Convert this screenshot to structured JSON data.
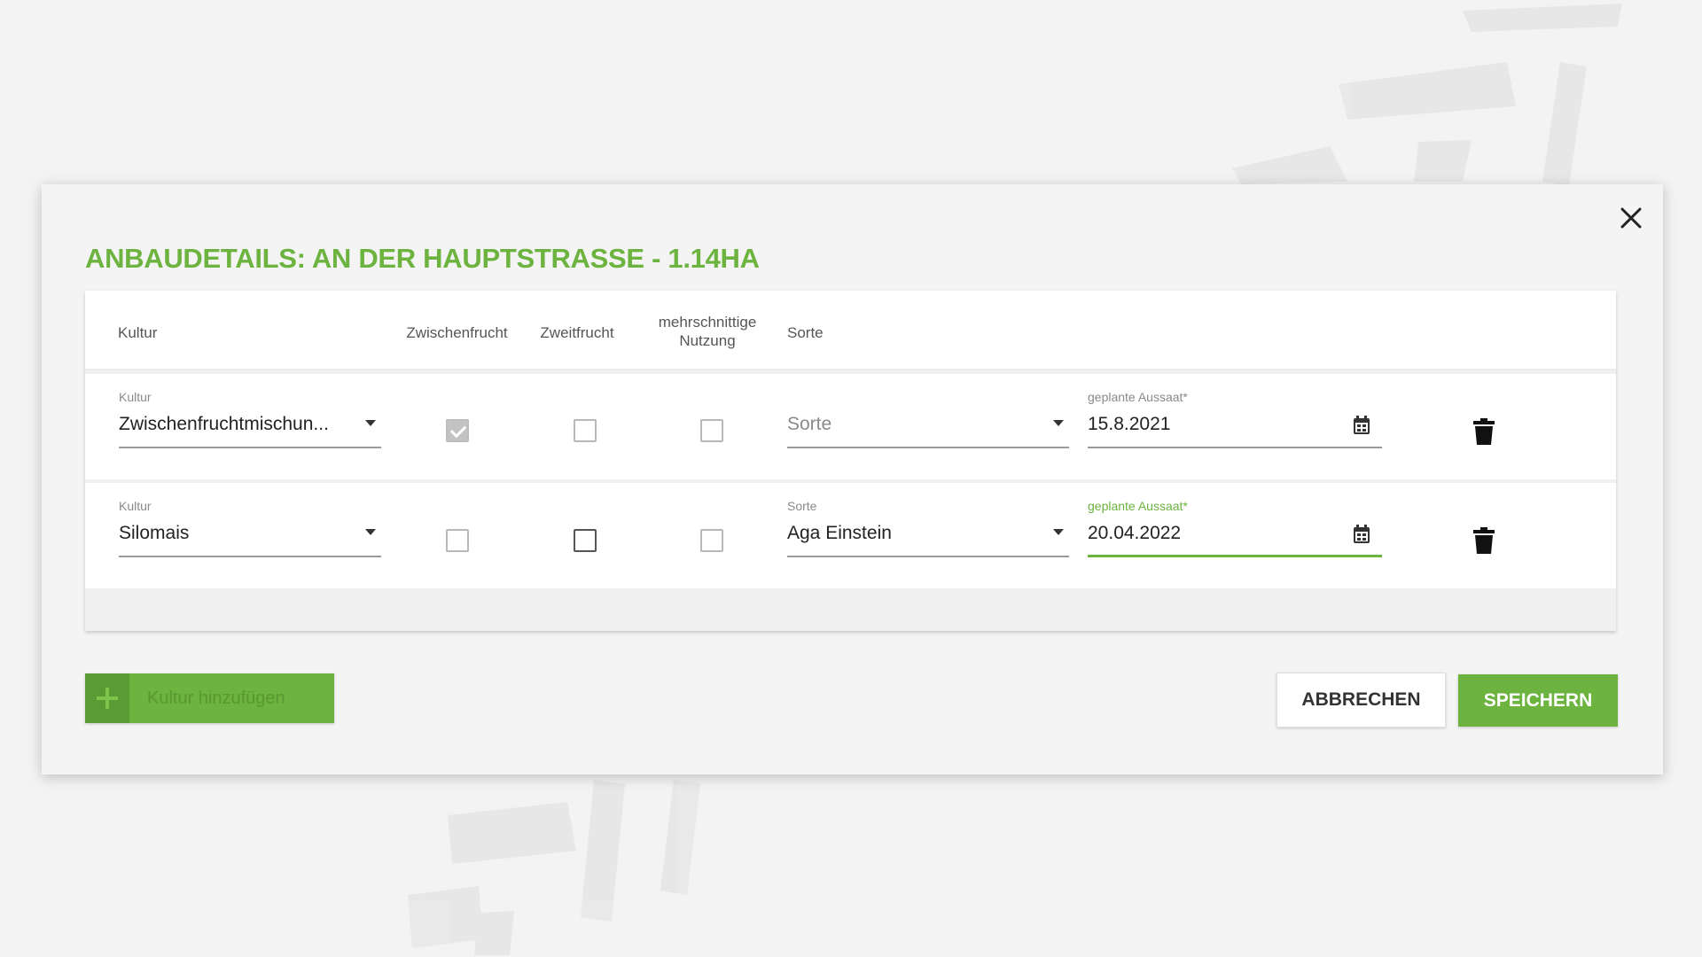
{
  "dialog": {
    "title": "ANBAUDETAILS: AN DER HAUPTSTRASSE - 1.14HA",
    "close_icon": "close-icon"
  },
  "table": {
    "headers": {
      "kultur": "Kultur",
      "zwischenfrucht": "Zwischenfrucht",
      "zweitfrucht": "Zweitfrucht",
      "mehrschnittige_line1": "mehrschnittige",
      "mehrschnittige_line2": "Nutzung",
      "sorte": "Sorte"
    },
    "rows": [
      {
        "kultur_label": "Kultur",
        "kultur_value": "Zwischenfruchtmischun...",
        "zwischenfrucht": true,
        "zwischenfrucht_disabled": true,
        "zweitfrucht": false,
        "mehrschnittige": false,
        "sorte_label": "",
        "sorte_value": "Sorte",
        "aussaat_label": "geplante Aussaat*",
        "aussaat_value": "15.8.2021",
        "aussaat_focused": false
      },
      {
        "kultur_label": "Kultur",
        "kultur_value": "Silomais",
        "zwischenfrucht": false,
        "zweitfrucht": false,
        "mehrschnittige": false,
        "sorte_label": "Sorte",
        "sorte_value": "Aga Einstein",
        "aussaat_label": "geplante Aussaat*",
        "aussaat_value": "20.04.2022",
        "aussaat_focused": true
      }
    ]
  },
  "actions": {
    "add_label": "Kultur hinzufügen",
    "cancel_label": "ABBRECHEN",
    "save_label": "SPEICHERN"
  },
  "colors": {
    "accent": "#6cb33f",
    "accent_dark": "#5a9c33",
    "background": "#f3f3f3"
  }
}
